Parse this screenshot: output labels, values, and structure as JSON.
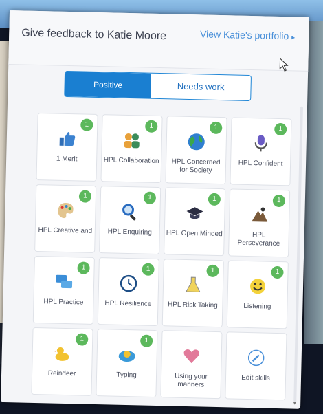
{
  "header": {
    "title": "Give feedback to Katie Moore",
    "portfolio_link": "View Katie's portfolio",
    "portfolio_arrow": "▸"
  },
  "toggle": {
    "positive": "Positive",
    "needs_work": "Needs work",
    "active": "Positive"
  },
  "tiles": [
    {
      "label": "1 Merit",
      "badge": "1",
      "icon": "thumbs-up-icon"
    },
    {
      "label": "HPL Collaboration",
      "badge": "1",
      "icon": "people-icon"
    },
    {
      "label": "HPL Concerned for Society",
      "badge": "1",
      "icon": "globe-icon"
    },
    {
      "label": "HPL Confident",
      "badge": "1",
      "icon": "microphone-icon"
    },
    {
      "label": "HPL Creative and",
      "badge": "1",
      "icon": "palette-icon"
    },
    {
      "label": "HPL Enquiring",
      "badge": "1",
      "icon": "magnifier-icon"
    },
    {
      "label": "HPL Open Minded",
      "badge": "1",
      "icon": "graduation-cap-icon"
    },
    {
      "label": "HPL Perseverance",
      "badge": "1",
      "icon": "hiker-icon"
    },
    {
      "label": "HPL Practice",
      "badge": "1",
      "icon": "chat-bubbles-icon"
    },
    {
      "label": "HPL Resilience",
      "badge": "1",
      "icon": "clock-icon"
    },
    {
      "label": "HPL Risk Taking",
      "badge": "1",
      "icon": "flask-icon"
    },
    {
      "label": "Listening",
      "badge": "1",
      "icon": "smiley-icon"
    },
    {
      "label": "Reindeer",
      "badge": "1",
      "icon": "duck-icon"
    },
    {
      "label": "Typing",
      "badge": "1",
      "icon": "typing-icon"
    },
    {
      "label": "Using your manners",
      "badge": "",
      "icon": "heart-icon"
    },
    {
      "label": "Edit skills",
      "badge": "",
      "icon": "pencil-icon"
    }
  ],
  "colors": {
    "accent": "#1a7fd1",
    "badge": "#5cb85c",
    "link": "#4a90d9"
  }
}
